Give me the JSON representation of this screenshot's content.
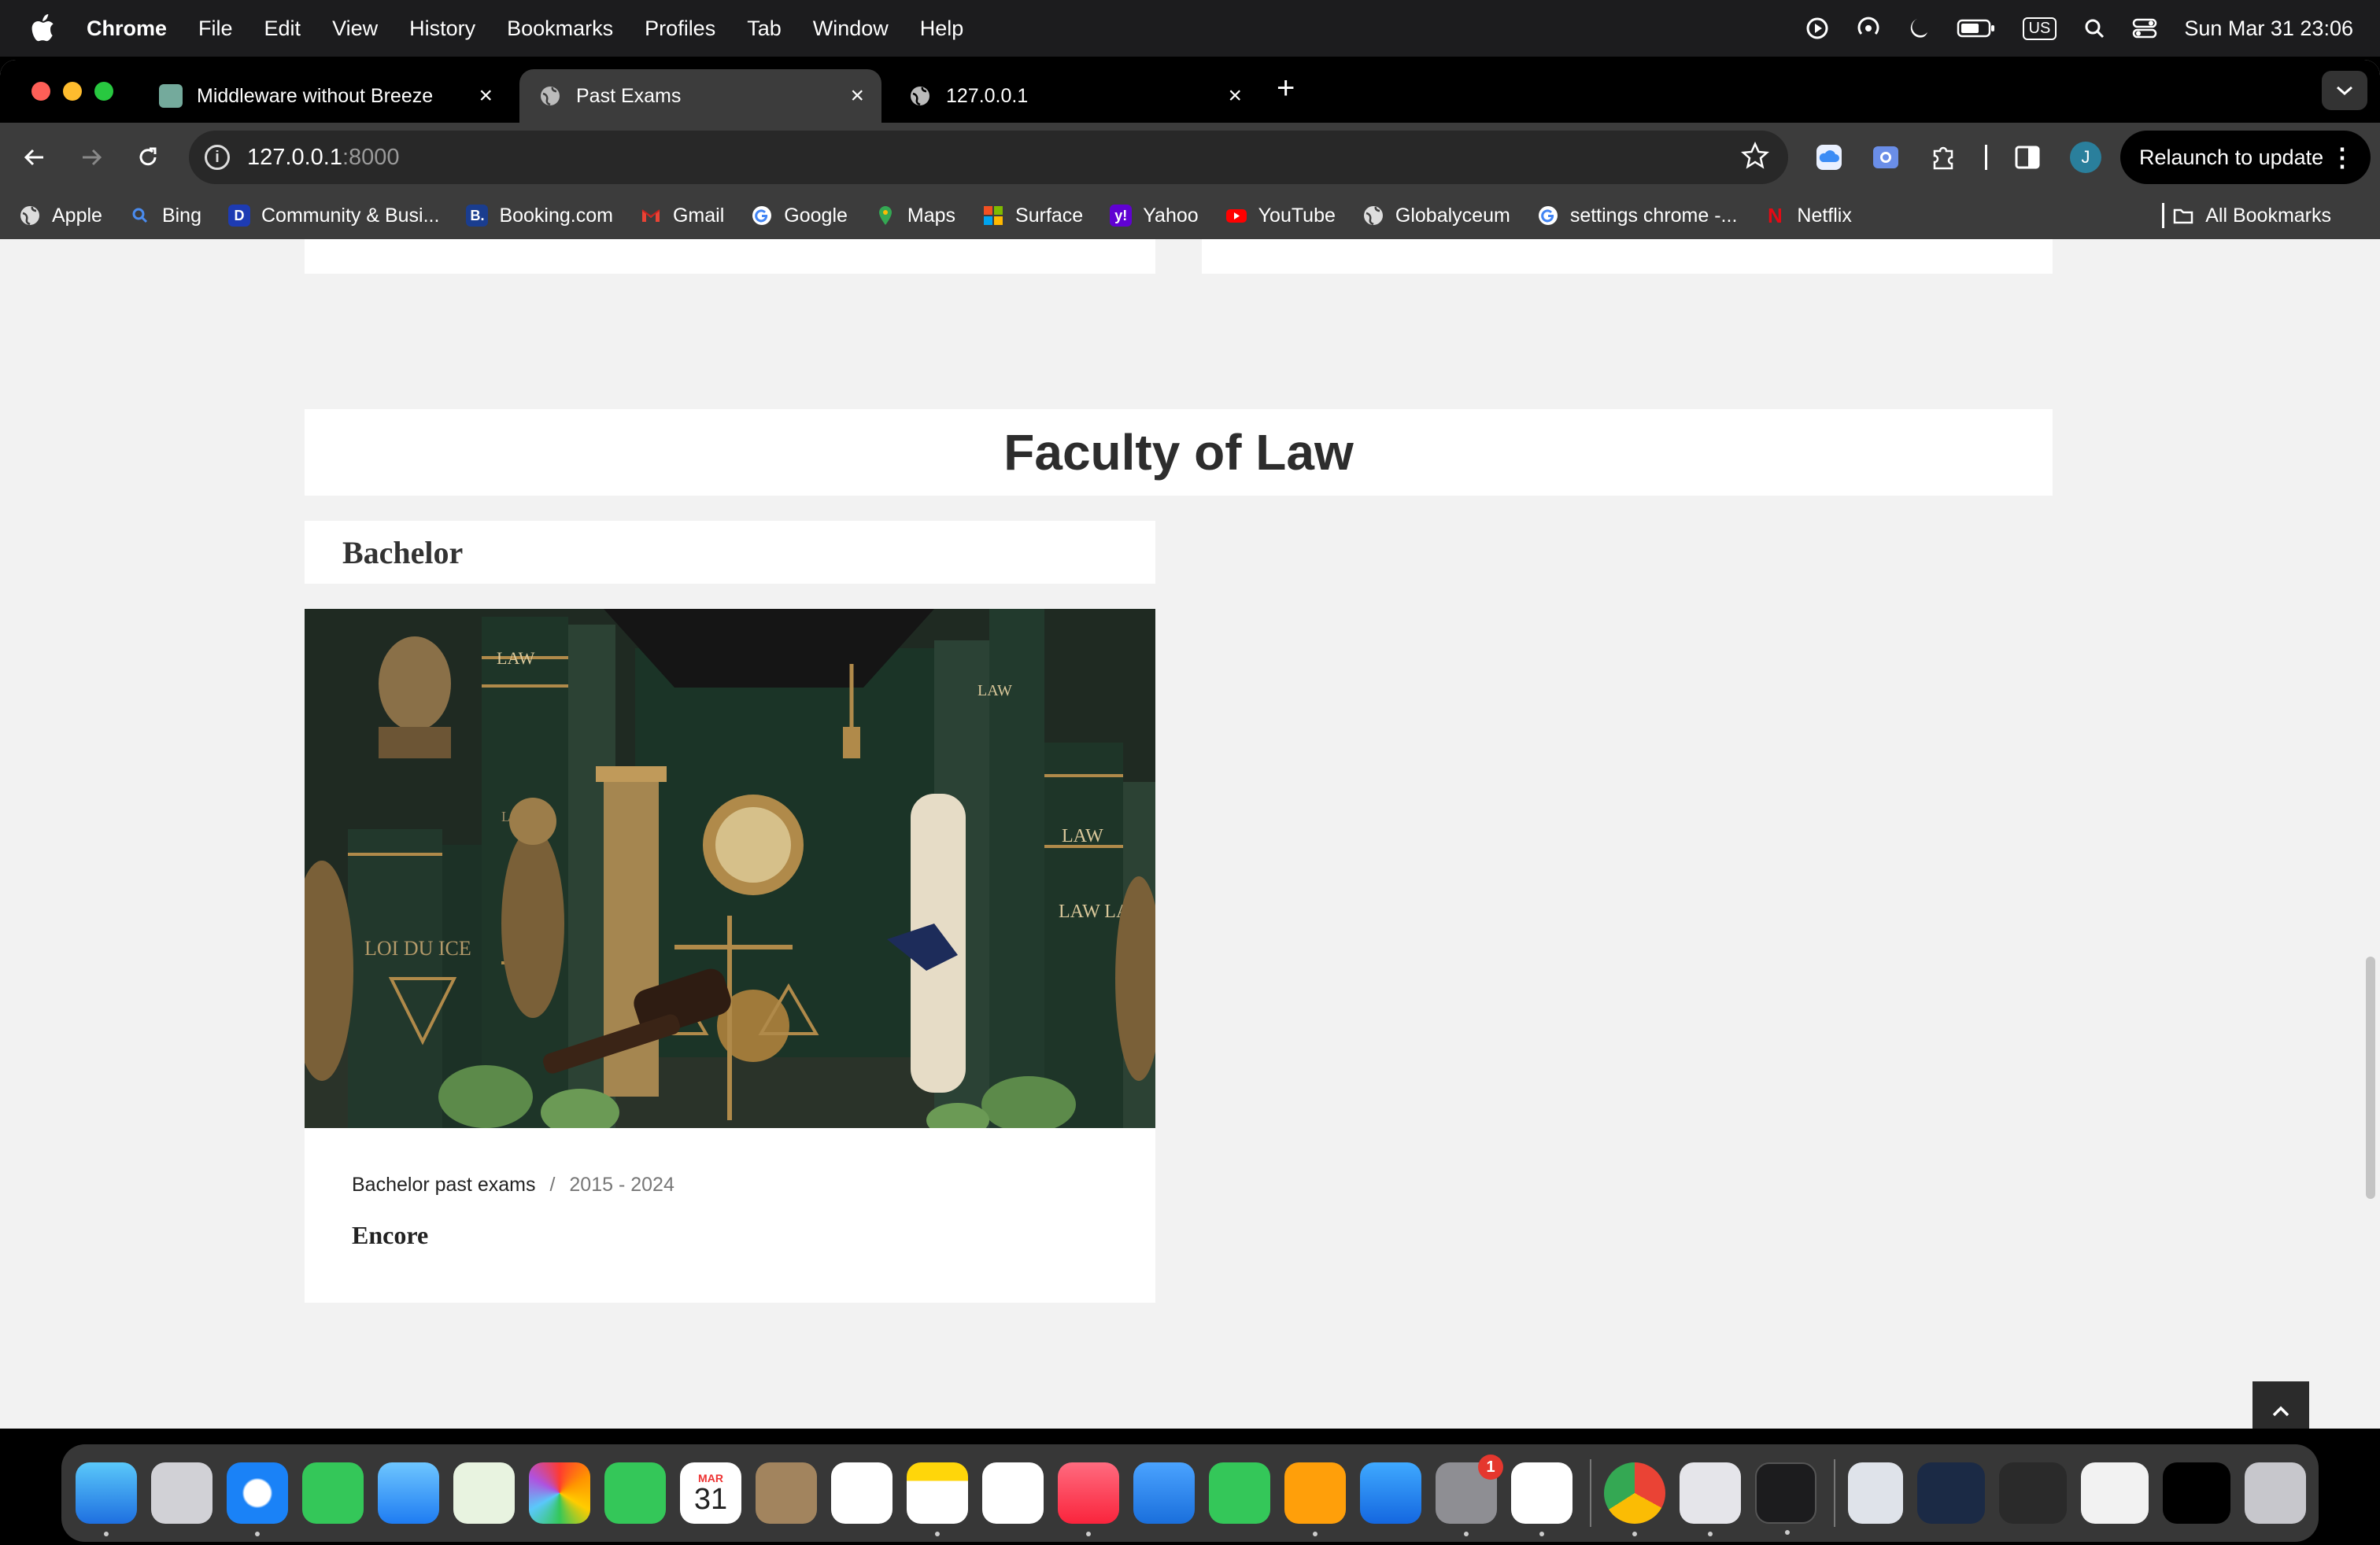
{
  "menubar": {
    "app": "Chrome",
    "items": [
      "File",
      "Edit",
      "View",
      "History",
      "Bookmarks",
      "Profiles",
      "Tab",
      "Window",
      "Help"
    ],
    "input_source": "US",
    "datetime": "Sun Mar 31  23:06"
  },
  "tabs": [
    {
      "title": "Middleware without Breeze",
      "active": false
    },
    {
      "title": "Past Exams",
      "active": true
    },
    {
      "title": "127.0.0.1",
      "active": false
    }
  ],
  "toolbar": {
    "url_host": "127.0.0.1",
    "url_port": ":8000",
    "relaunch_label": "Relaunch to update",
    "avatar_letter": "J"
  },
  "bookmarks": {
    "items": [
      "Apple",
      "Bing",
      "Community & Busi...",
      "Booking.com",
      "Gmail",
      "Google",
      "Maps",
      "Surface",
      "Yahoo",
      "YouTube",
      "Globalyceum",
      "settings chrome -...",
      "Netflix"
    ],
    "all_label": "All Bookmarks"
  },
  "page": {
    "faculty_title": "Faculty of Law",
    "level_title": "Bachelor",
    "course": {
      "category": "Bachelor past exams",
      "separator": "/",
      "years": "2015 - 2024",
      "name": "Encore",
      "image_book_labels": [
        "LAW",
        "LAW",
        "LAW",
        "LAW",
        "LAW LAW",
        "LOI DU ICE"
      ]
    }
  },
  "dock": {
    "calendar_month": "MAR",
    "calendar_day": "31",
    "settings_badge": "1"
  },
  "colors": {
    "menubar_bg": "#1c1c1e",
    "tab_active": "#3c3c3c",
    "page_bg": "#f2f2f2",
    "card_bg": "#ffffff",
    "scroll_top_button": "#2b2b2b"
  }
}
